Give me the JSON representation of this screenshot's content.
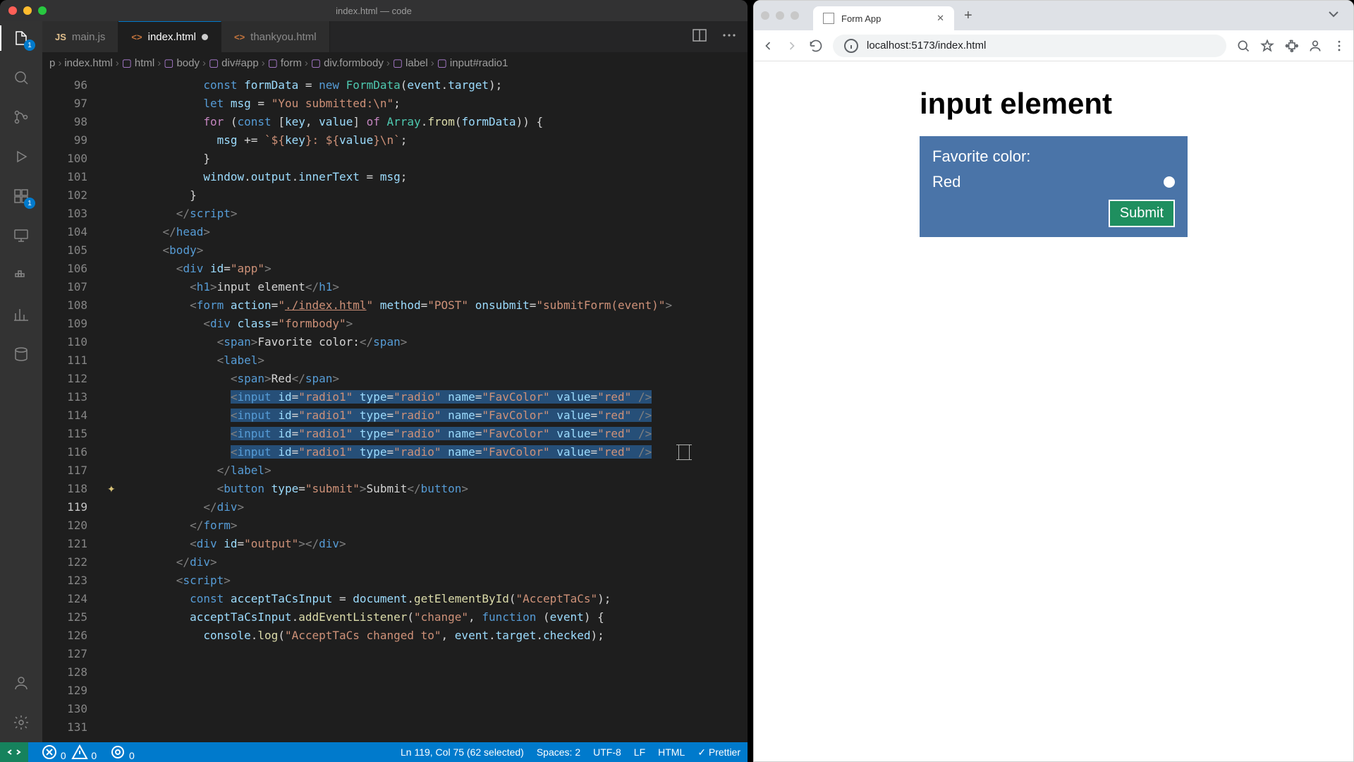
{
  "vscode": {
    "window_title": "index.html — code",
    "tabs": [
      {
        "icon": "JS",
        "label": "main.js"
      },
      {
        "icon": "<>",
        "label": "index.html",
        "active": true,
        "dirty": true
      },
      {
        "icon": "<>",
        "label": "thankyou.html"
      }
    ],
    "activity_badges": {
      "explorer": "1",
      "extensions": "1"
    },
    "breadcrumb": [
      "p",
      "index.html",
      "html",
      "body",
      "div#app",
      "form",
      "div.formbody",
      "label",
      "input#radio1"
    ],
    "lines": [
      {
        "n": 96,
        "indent": 10,
        "html": "<span class='kw2'>const</span> <span class='var'>formData</span> <span class='pun'>=</span> <span class='kw2'>new</span> <span class='cls'>FormData</span><span class='pun'>(</span><span class='var'>event</span><span class='pun'>.</span><span class='var'>target</span><span class='pun'>);</span>"
      },
      {
        "n": 97,
        "indent": 10,
        "html": "<span class='kw2'>let</span> <span class='var'>msg</span> <span class='pun'>=</span> <span class='str'>\"You submitted:\\n\"</span><span class='pun'>;</span>"
      },
      {
        "n": 98,
        "indent": 0,
        "html": ""
      },
      {
        "n": 99,
        "indent": 10,
        "html": "<span class='kw'>for</span> <span class='pun'>(</span><span class='kw2'>const</span> <span class='pun'>[</span><span class='var'>key</span><span class='pun'>,</span> <span class='var'>value</span><span class='pun'>]</span> <span class='kw'>of</span> <span class='cls'>Array</span><span class='pun'>.</span><span class='fn'>from</span><span class='pun'>(</span><span class='var'>formData</span><span class='pun'>)) {</span>"
      },
      {
        "n": 100,
        "indent": 12,
        "html": "<span class='var'>msg</span> <span class='pun'>+=</span> <span class='tpl'>`${</span><span class='var'>key</span><span class='tpl'>}: ${</span><span class='var'>value</span><span class='tpl'>}\\n`</span><span class='pun'>;</span>"
      },
      {
        "n": 101,
        "indent": 10,
        "html": "<span class='pun'>}</span>"
      },
      {
        "n": 102,
        "indent": 0,
        "html": ""
      },
      {
        "n": 103,
        "indent": 10,
        "html": "<span class='var'>window</span><span class='pun'>.</span><span class='var'>output</span><span class='pun'>.</span><span class='var'>innerText</span> <span class='pun'>=</span> <span class='var'>msg</span><span class='pun'>;</span>"
      },
      {
        "n": 104,
        "indent": 8,
        "html": "<span class='pun'>}</span>"
      },
      {
        "n": 105,
        "indent": 6,
        "html": "<span class='ang'>&lt;/</span><span class='tag'>script</span><span class='ang'>&gt;</span>"
      },
      {
        "n": 106,
        "indent": 4,
        "html": "<span class='ang'>&lt;/</span><span class='tag'>head</span><span class='ang'>&gt;</span>"
      },
      {
        "n": 107,
        "indent": 4,
        "html": "<span class='ang'>&lt;</span><span class='tag'>body</span><span class='ang'>&gt;</span>"
      },
      {
        "n": 108,
        "indent": 6,
        "html": "<span class='ang'>&lt;</span><span class='tag'>div</span> <span class='attr'>id</span><span class='pun'>=</span><span class='str'>\"app\"</span><span class='ang'>&gt;</span>"
      },
      {
        "n": 109,
        "indent": 8,
        "html": "<span class='ang'>&lt;</span><span class='tag'>h1</span><span class='ang'>&gt;</span>input element<span class='ang'>&lt;/</span><span class='tag'>h1</span><span class='ang'>&gt;</span>"
      },
      {
        "n": 110,
        "indent": 8,
        "html": "<span class='ang'>&lt;</span><span class='tag'>form</span> <span class='attr'>action</span><span class='pun'>=</span><span class='str'>\"<u>./index.html</u>\"</span> <span class='attr'>method</span><span class='pun'>=</span><span class='str'>\"POST\"</span> <span class='attr'>onsubmit</span><span class='pun'>=</span><span class='str'>\"submitForm(event)\"</span><span class='ang'>&gt;</span>"
      },
      {
        "n": 111,
        "indent": 10,
        "html": "<span class='ang'>&lt;</span><span class='tag'>div</span> <span class='attr'>class</span><span class='pun'>=</span><span class='str'>\"formbody\"</span><span class='ang'>&gt;</span>"
      },
      {
        "n": 112,
        "indent": 12,
        "html": "<span class='ang'>&lt;</span><span class='tag'>span</span><span class='ang'>&gt;</span>Favorite color:<span class='ang'>&lt;/</span><span class='tag'>span</span><span class='ang'>&gt;</span>"
      },
      {
        "n": 113,
        "indent": 12,
        "html": "<span class='ang'>&lt;</span><span class='tag'>label</span><span class='ang'>&gt;</span>"
      },
      {
        "n": 114,
        "indent": 14,
        "html": "<span class='ang'>&lt;</span><span class='tag'>span</span><span class='ang'>&gt;</span>Red<span class='ang'>&lt;/</span><span class='tag'>span</span><span class='ang'>&gt;</span>"
      },
      {
        "n": 115,
        "indent": 0,
        "html": ""
      },
      {
        "n": 116,
        "indent": 14,
        "sel": true,
        "html": "<span class='ang'>&lt;</span><span class='tag'>input</span> <span class='attr'>id</span><span class='pun'>=</span><span class='str'>\"radio1\"</span> <span class='attr'>type</span><span class='pun'>=</span><span class='str'>\"radio\"</span> <span class='attr'>name</span><span class='pun'>=</span><span class='str'>\"FavColor\"</span> <span class='attr'>value</span><span class='pun'>=</span><span class='str'>\"red\"</span> <span class='ang'>/&gt;</span>"
      },
      {
        "n": 117,
        "indent": 14,
        "sel": true,
        "html": "<span class='ang'>&lt;</span><span class='tag'>input</span> <span class='attr'>id</span><span class='pun'>=</span><span class='str'>\"radio1\"</span> <span class='attr'>type</span><span class='pun'>=</span><span class='str'>\"radio\"</span> <span class='attr'>name</span><span class='pun'>=</span><span class='str'>\"FavColor\"</span> <span class='attr'>value</span><span class='pun'>=</span><span class='str'>\"red\"</span> <span class='ang'>/&gt;</span>"
      },
      {
        "n": 118,
        "indent": 14,
        "sel": true,
        "mark": "✦",
        "html": "<span class='ang'>&lt;</span><span class='tag'>input</span> <span class='attr'>id</span><span class='pun'>=</span><span class='str'>\"radio1\"</span> <span class='attr'>type</span><span class='pun'>=</span><span class='str'>\"radio\"</span> <span class='attr'>name</span><span class='pun'>=</span><span class='str'>\"FavColor\"</span> <span class='attr'>value</span><span class='pun'>=</span><span class='str'>\"red\"</span> <span class='ang'>/&gt;</span>"
      },
      {
        "n": 119,
        "indent": 14,
        "sel": true,
        "cur": true,
        "html": "<span class='ang'>&lt;</span><span class='tag'>input</span> <span class='attr'>id</span><span class='pun'>=</span><span class='str'>\"radio1\"</span> <span class='attr'>type</span><span class='pun'>=</span><span class='str'>\"radio\"</span> <span class='attr'>name</span><span class='pun'>=</span><span class='str'>\"FavColor\"</span> <span class='attr'>value</span><span class='pun'>=</span><span class='str'>\"red\"</span> <span class='ang'>/&gt;</span>"
      },
      {
        "n": 120,
        "indent": 12,
        "html": "<span class='ang'>&lt;/</span><span class='tag'>label</span><span class='ang'>&gt;</span>"
      },
      {
        "n": 121,
        "indent": 0,
        "html": ""
      },
      {
        "n": 122,
        "indent": 12,
        "html": "<span class='ang'>&lt;</span><span class='tag'>button</span> <span class='attr'>type</span><span class='pun'>=</span><span class='str'>\"submit\"</span><span class='ang'>&gt;</span>Submit<span class='ang'>&lt;/</span><span class='tag'>button</span><span class='ang'>&gt;</span>"
      },
      {
        "n": 123,
        "indent": 10,
        "html": "<span class='ang'>&lt;/</span><span class='tag'>div</span><span class='ang'>&gt;</span>"
      },
      {
        "n": 124,
        "indent": 8,
        "html": "<span class='ang'>&lt;/</span><span class='tag'>form</span><span class='ang'>&gt;</span>"
      },
      {
        "n": 125,
        "indent": 0,
        "html": ""
      },
      {
        "n": 126,
        "indent": 8,
        "html": "<span class='ang'>&lt;</span><span class='tag'>div</span> <span class='attr'>id</span><span class='pun'>=</span><span class='str'>\"output\"</span><span class='ang'>&gt;&lt;/</span><span class='tag'>div</span><span class='ang'>&gt;</span>"
      },
      {
        "n": 127,
        "indent": 6,
        "html": "<span class='ang'>&lt;/</span><span class='tag'>div</span><span class='ang'>&gt;</span>"
      },
      {
        "n": 128,
        "indent": 6,
        "html": "<span class='ang'>&lt;</span><span class='tag'>script</span><span class='ang'>&gt;</span>"
      },
      {
        "n": 129,
        "indent": 8,
        "html": "<span class='kw2'>const</span> <span class='var'>acceptTaCsInput</span> <span class='pun'>=</span> <span class='var'>document</span><span class='pun'>.</span><span class='fn'>getElementById</span><span class='pun'>(</span><span class='str'>\"AcceptTaCs\"</span><span class='pun'>);</span>"
      },
      {
        "n": 130,
        "indent": 8,
        "html": "<span class='var'>acceptTaCsInput</span><span class='pun'>.</span><span class='fn'>addEventListener</span><span class='pun'>(</span><span class='str'>\"change\"</span><span class='pun'>,</span> <span class='kw2'>function</span> <span class='pun'>(</span><span class='var'>event</span><span class='pun'>) {</span>"
      },
      {
        "n": 131,
        "indent": 10,
        "html": "<span class='var'>console</span><span class='pun'>.</span><span class='fn'>log</span><span class='pun'>(</span><span class='str'>\"AcceptTaCs changed to\"</span><span class='pun'>,</span> <span class='var'>event</span><span class='pun'>.</span><span class='var'>target</span><span class='pun'>.</span><span class='var'>checked</span><span class='pun'>);</span>"
      }
    ],
    "status": {
      "errors": "0",
      "warnings": "0",
      "ports": "0",
      "cursor": "Ln 119, Col 75 (62 selected)",
      "spaces": "Spaces: 2",
      "encoding": "UTF-8",
      "eol": "LF",
      "lang": "HTML",
      "prettier": "Prettier"
    }
  },
  "browser": {
    "tab_title": "Form App",
    "url": "localhost:5173/index.html",
    "page": {
      "heading": "input element",
      "label": "Favorite color:",
      "option": "Red",
      "submit": "Submit"
    }
  }
}
